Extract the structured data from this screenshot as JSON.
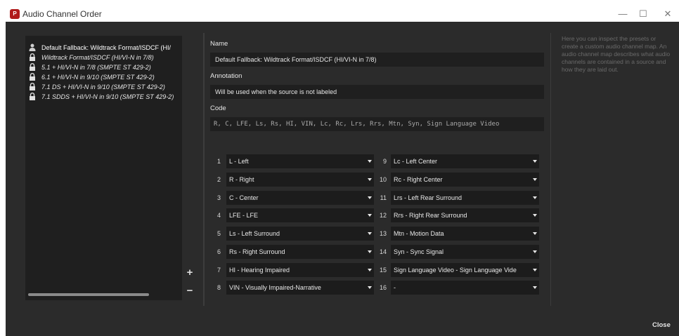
{
  "window": {
    "title": "Audio Channel Order",
    "controls": {
      "minimize": "—",
      "maximize": "☐",
      "close": "✕"
    }
  },
  "presets": [
    {
      "label": "Default Fallback: Wildtrack Format/ISDCF (HI/",
      "icon": "user-icon",
      "selected": true
    },
    {
      "label": "Wildtrack Format/ISDCF (HI/VI-N in 7/8)",
      "icon": "lock-icon"
    },
    {
      "label": "5.1 + HI/VI-N in 7/8 (SMPTE ST 429-2)",
      "icon": "lock-icon"
    },
    {
      "label": "6.1 + HI/VI-N in 9/10 (SMPTE ST 429-2)",
      "icon": "lock-icon"
    },
    {
      "label": "7.1 DS + HI/VI-N in 9/10 (SMPTE ST 429-2)",
      "icon": "lock-icon"
    },
    {
      "label": "7.1 SDDS + HI/VI-N in 9/10 (SMPTE ST 429-2)",
      "icon": "lock-icon"
    }
  ],
  "buttons": {
    "add": "+",
    "remove": "−",
    "close": "Close"
  },
  "form": {
    "name_label": "Name",
    "name_value": "Default Fallback: Wildtrack Format/ISDCF (HI/VI-N in 7/8)",
    "annotation_label": "Annotation",
    "annotation_value": "Will be used when the source is not labeled",
    "code_label": "Code",
    "code_value": "R, C, LFE, Ls, Rs, HI, VIN, Lc, Rc, Lrs, Rrs, Mtn, Syn, Sign Language Video"
  },
  "channels_left": [
    {
      "num": "1",
      "value": "L -  Left"
    },
    {
      "num": "2",
      "value": "R -  Right"
    },
    {
      "num": "3",
      "value": "C -  Center"
    },
    {
      "num": "4",
      "value": "LFE -  LFE"
    },
    {
      "num": "5",
      "value": "Ls -  Left Surround"
    },
    {
      "num": "6",
      "value": "Rs -  Right Surround"
    },
    {
      "num": "7",
      "value": "HI -  Hearing Impaired"
    },
    {
      "num": "8",
      "value": "VIN -  Visually Impaired-Narrative"
    }
  ],
  "channels_right": [
    {
      "num": "9",
      "value": "Lc -  Left Center"
    },
    {
      "num": "10",
      "value": "Rc -  Right Center"
    },
    {
      "num": "11",
      "value": "Lrs -  Left Rear Surround"
    },
    {
      "num": "12",
      "value": "Rrs -  Right Rear Surround"
    },
    {
      "num": "13",
      "value": "Mtn -  Motion Data"
    },
    {
      "num": "14",
      "value": "Syn -  Sync Signal"
    },
    {
      "num": "15",
      "value": "Sign Language Video -  Sign Language Vide"
    },
    {
      "num": "16",
      "value": "-"
    }
  ],
  "help_text": "Here you can inspect the presets or create a custom audio channel map. An audio channel map describes what audio channels are contained in a source and how they are laid out."
}
